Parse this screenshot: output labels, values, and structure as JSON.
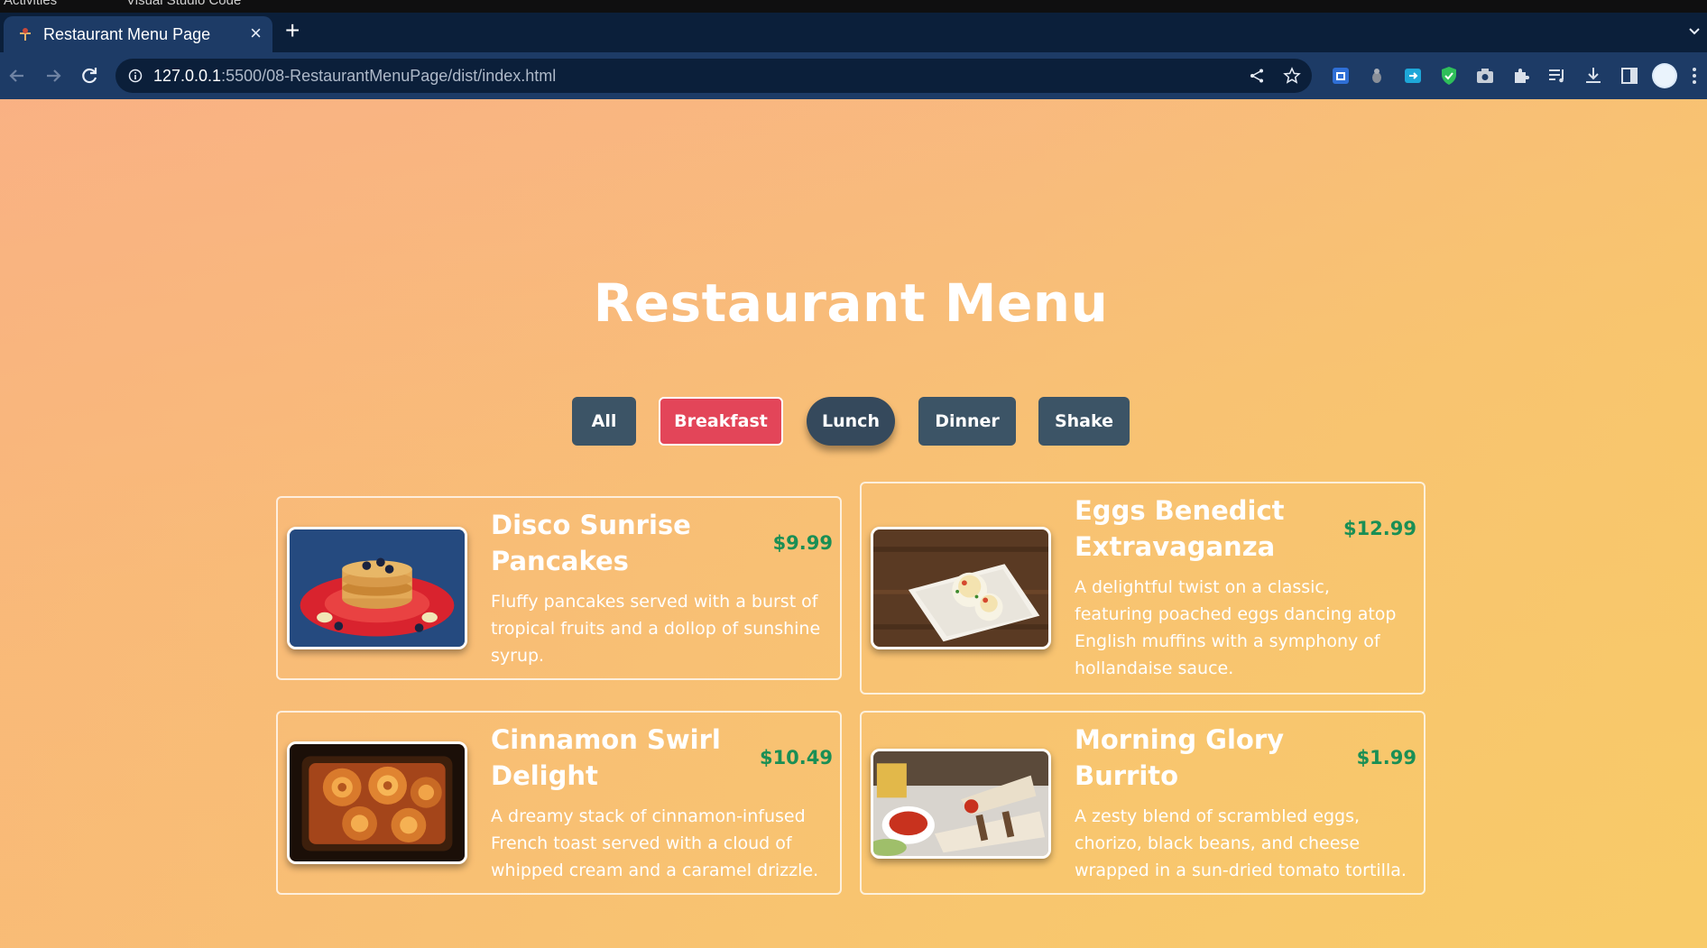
{
  "os_bar": {
    "left_items": [
      "Activities",
      "Visual Studio Code"
    ]
  },
  "browser": {
    "tab": {
      "title": "Restaurant Menu Page"
    },
    "address": {
      "host": "127.0.0.1",
      "path": ":5500/08-RestaurantMenuPage/dist/index.html"
    },
    "extensions": [
      "extension-1-icon",
      "extension-2-icon",
      "extension-3-icon",
      "shield-extension-icon",
      "camera-extension-icon",
      "puzzle-icon",
      "reading-list-icon",
      "download-icon",
      "side-panel-icon",
      "profile-avatar",
      "more-icon"
    ]
  },
  "page": {
    "title": "Restaurant Menu",
    "filters": [
      {
        "label": "All",
        "state": "normal"
      },
      {
        "label": "Breakfast",
        "state": "active"
      },
      {
        "label": "Lunch",
        "state": "hover"
      },
      {
        "label": "Dinner",
        "state": "normal"
      },
      {
        "label": "Shake",
        "state": "normal"
      }
    ],
    "colors": {
      "filter_button": "#3c5466",
      "filter_active": "#e34559",
      "price": "#1a8f55"
    },
    "items": [
      {
        "name": "Disco Sunrise Pancakes",
        "price": "$9.99",
        "description": "Fluffy pancakes served with a burst of tropical fruits and a dollop of sunshine syrup.",
        "image": "pancakes-photo"
      },
      {
        "name": "Eggs Benedict Extravaganza",
        "price": "$12.99",
        "description": "A delightful twist on a classic, featuring poached eggs dancing atop English muffins with a symphony of hollandaise sauce.",
        "image": "eggs-benedict-photo"
      },
      {
        "name": "Cinnamon Swirl Delight",
        "price": "$10.49",
        "description": "A dreamy stack of cinnamon-infused French toast served with a cloud of whipped cream and a caramel drizzle.",
        "image": "cinnamon-rolls-photo"
      },
      {
        "name": "Morning Glory Burrito",
        "price": "$1.99",
        "description": "A zesty blend of scrambled eggs, chorizo, black beans, and cheese wrapped in a sun-dried tomato tortilla.",
        "image": "burrito-photo"
      }
    ]
  }
}
